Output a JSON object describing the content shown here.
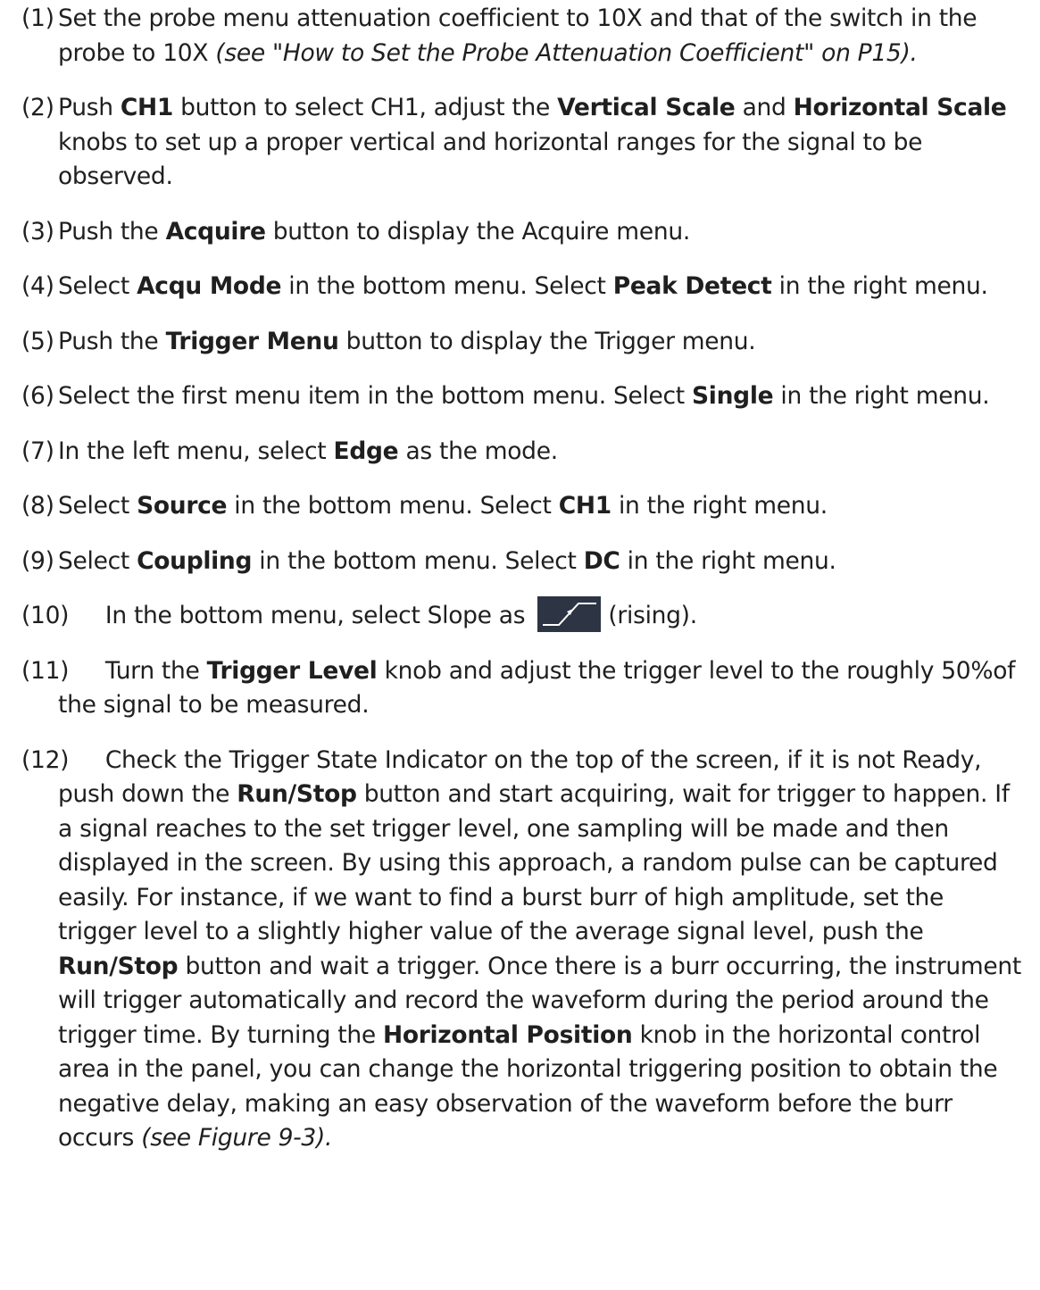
{
  "steps": [
    {
      "num": "(1)",
      "parts": [
        {
          "t": "Set the probe menu attenuation coefficient to 10X and that of the switch in the probe to 10X "
        },
        {
          "t": "(see \"How to Set the Probe Attenuation Coefficient\" on P15).",
          "s": "i"
        }
      ]
    },
    {
      "num": "(2)",
      "parts": [
        {
          "t": "Push "
        },
        {
          "t": "CH1",
          "s": "b"
        },
        {
          "t": " button to select CH1, adjust the "
        },
        {
          "t": "Vertical Scale",
          "s": "b"
        },
        {
          "t": " and "
        },
        {
          "t": "Horizontal Scale",
          "s": "b"
        },
        {
          "t": " knobs to set up a proper vertical and horizontal ranges for the signal to be observed."
        }
      ]
    },
    {
      "num": "(3)",
      "parts": [
        {
          "t": "Push the "
        },
        {
          "t": "Acquire",
          "s": "b"
        },
        {
          "t": " button to display the Acquire menu."
        }
      ]
    },
    {
      "num": "(4)",
      "parts": [
        {
          "t": "Select "
        },
        {
          "t": "Acqu Mode",
          "s": "b"
        },
        {
          "t": " in the bottom menu. Select "
        },
        {
          "t": "Peak Detect",
          "s": "b"
        },
        {
          "t": " in the right menu."
        }
      ]
    },
    {
      "num": "(5)",
      "parts": [
        {
          "t": "Push the "
        },
        {
          "t": "Trigger Menu",
          "s": "b"
        },
        {
          "t": " button to display the Trigger menu."
        }
      ]
    },
    {
      "num": "(6)",
      "parts": [
        {
          "t": "Select the first menu item in the bottom menu. Select "
        },
        {
          "t": "Single",
          "s": "b"
        },
        {
          "t": " in the right menu."
        }
      ]
    },
    {
      "num": "(7)",
      "parts": [
        {
          "t": "In the left menu, select "
        },
        {
          "t": "Edge",
          "s": "b"
        },
        {
          "t": " as the mode."
        }
      ]
    },
    {
      "num": "(8)",
      "parts": [
        {
          "t": "Select "
        },
        {
          "t": "Source",
          "s": "b"
        },
        {
          "t": " in the bottom menu. Select "
        },
        {
          "t": "CH1",
          "s": "b"
        },
        {
          "t": " in the right menu."
        }
      ]
    },
    {
      "num": "(9)",
      "parts": [
        {
          "t": "Select "
        },
        {
          "t": "Coupling",
          "s": "b"
        },
        {
          "t": " in the bottom menu. Select "
        },
        {
          "t": "DC",
          "s": "b"
        },
        {
          "t": " in the right menu."
        }
      ]
    },
    {
      "num": "(10)",
      "parts": [
        {
          "t": "In the bottom menu, select Slope as "
        },
        {
          "icon": "rising-slope-icon"
        },
        {
          "t": "(rising)."
        }
      ]
    },
    {
      "num": "(11)",
      "parts": [
        {
          "t": "Turn the "
        },
        {
          "t": "Trigger Level",
          "s": "b"
        },
        {
          "t": " knob and adjust the trigger level to the roughly 50%of the signal to be measured."
        }
      ]
    },
    {
      "num": "(12)",
      "parts": [
        {
          "t": "Check the Trigger State Indicator on the top of the screen, if it is not Ready, push down the "
        },
        {
          "t": "Run/Stop",
          "s": "b"
        },
        {
          "t": " button and start acquiring, wait for trigger to happen. If a signal reaches to the set trigger level, one sampling will be made and then displayed in the screen. By using this approach, a random pulse can be captured easily. For instance, if we want to find a burst burr of high amplitude, set the trigger level to a slightly higher value of the average signal level, push the "
        },
        {
          "t": "Run/Stop",
          "s": "b"
        },
        {
          "t": " button and wait a trigger. Once there is a burr occurring, the instrument will trigger automatically and record the waveform during the period around the trigger time. By turning the "
        },
        {
          "t": "Horizontal Position",
          "s": "b"
        },
        {
          "t": " knob in the horizontal control area in the panel, you can change the horizontal triggering position to obtain the negative delay, making an easy observation of the waveform before the burr occurs "
        },
        {
          "t": "(see Figure 9-3).",
          "s": "i"
        }
      ]
    }
  ],
  "colors": {
    "text": "#1f1f1f",
    "icon_bg": "#2d3444",
    "icon_line": "#ffffff"
  }
}
